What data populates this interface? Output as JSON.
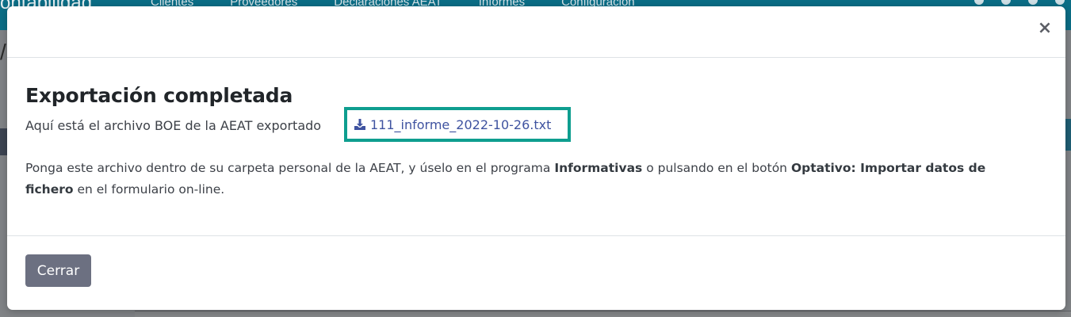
{
  "background": {
    "brand": "ontabilidad",
    "menu": [
      "Clientes",
      "Proveedores",
      "Declaraciones AEAT",
      "Informes",
      "Configuración"
    ]
  },
  "modal": {
    "title": "Exportación completada",
    "file_intro": "Aquí está el archivo BOE de la AEAT exportado",
    "file_name": "111_informe_2022-10-26.txt",
    "desc_part1": "Ponga este archivo dentro de su carpeta personal de la AEAT, y úselo en el programa ",
    "desc_bold1": "Informativas",
    "desc_part2": " o pulsando en el botón ",
    "desc_bold2": "Optativo: Importar datos de fichero",
    "desc_part3": " en el formulario on-line.",
    "close_icon_glyph": "×",
    "close_button_label": "Cerrar"
  },
  "colors": {
    "highlight_border": "#0e9e8f",
    "link": "#3f53a0",
    "button_bg": "#6c7081",
    "navbar": "#0b6e86"
  },
  "icons": {
    "download": "download-icon",
    "close": "close-icon"
  }
}
